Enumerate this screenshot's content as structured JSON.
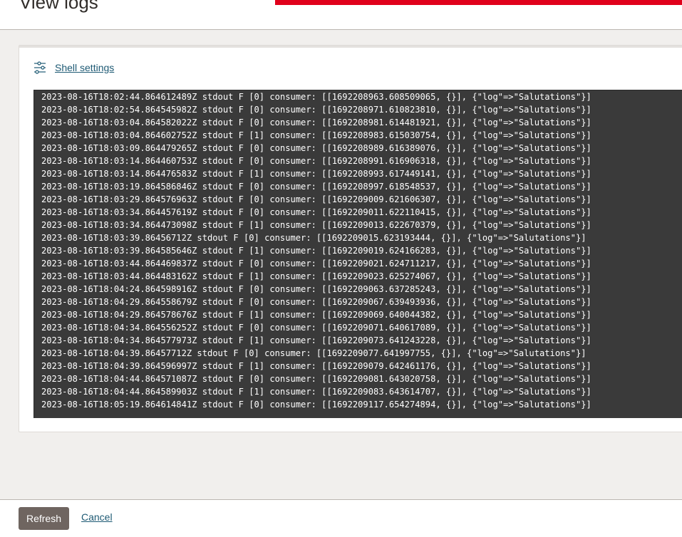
{
  "header": {
    "title": "View logs",
    "accent_color": "#e0001b"
  },
  "panel": {
    "shell_settings_label": "Shell settings",
    "shell_settings_icon": "sliders-icon"
  },
  "logs": [
    "2023-08-16T18:02:44.864612489Z stdout F [0] consumer: [[1692208963.608509065, {}], {\"log\"=>\"Salutations\"}]",
    "2023-08-16T18:02:54.864545982Z stdout F [0] consumer: [[1692208971.610823810, {}], {\"log\"=>\"Salutations\"}]",
    "2023-08-16T18:03:04.864582022Z stdout F [0] consumer: [[1692208981.614481921, {}], {\"log\"=>\"Salutations\"}]",
    "2023-08-16T18:03:04.864602752Z stdout F [1] consumer: [[1692208983.615030754, {}], {\"log\"=>\"Salutations\"}]",
    "2023-08-16T18:03:09.864479265Z stdout F [0] consumer: [[1692208989.616389076, {}], {\"log\"=>\"Salutations\"}]",
    "2023-08-16T18:03:14.864460753Z stdout F [0] consumer: [[1692208991.616906318, {}], {\"log\"=>\"Salutations\"}]",
    "2023-08-16T18:03:14.864476583Z stdout F [1] consumer: [[1692208993.617449141, {}], {\"log\"=>\"Salutations\"}]",
    "2023-08-16T18:03:19.864586846Z stdout F [0] consumer: [[1692208997.618548537, {}], {\"log\"=>\"Salutations\"}]",
    "2023-08-16T18:03:29.864576963Z stdout F [0] consumer: [[1692209009.621606307, {}], {\"log\"=>\"Salutations\"}]",
    "2023-08-16T18:03:34.864457619Z stdout F [0] consumer: [[1692209011.622110415, {}], {\"log\"=>\"Salutations\"}]",
    "2023-08-16T18:03:34.864473098Z stdout F [1] consumer: [[1692209013.622670379, {}], {\"log\"=>\"Salutations\"}]",
    "2023-08-16T18:03:39.86456712Z stdout F [0] consumer: [[1692209015.623193444, {}], {\"log\"=>\"Salutations\"}]",
    "2023-08-16T18:03:39.864585646Z stdout F [1] consumer: [[1692209019.624166283, {}], {\"log\"=>\"Salutations\"}]",
    "2023-08-16T18:03:44.864469837Z stdout F [0] consumer: [[1692209021.624711217, {}], {\"log\"=>\"Salutations\"}]",
    "2023-08-16T18:03:44.864483162Z stdout F [1] consumer: [[1692209023.625274067, {}], {\"log\"=>\"Salutations\"}]",
    "2023-08-16T18:04:24.864598916Z stdout F [0] consumer: [[1692209063.637285243, {}], {\"log\"=>\"Salutations\"}]",
    "2023-08-16T18:04:29.864558679Z stdout F [0] consumer: [[1692209067.639493936, {}], {\"log\"=>\"Salutations\"}]",
    "2023-08-16T18:04:29.864578676Z stdout F [1] consumer: [[1692209069.640044382, {}], {\"log\"=>\"Salutations\"}]",
    "2023-08-16T18:04:34.864556252Z stdout F [0] consumer: [[1692209071.640617089, {}], {\"log\"=>\"Salutations\"}]",
    "2023-08-16T18:04:34.864577973Z stdout F [1] consumer: [[1692209073.641243228, {}], {\"log\"=>\"Salutations\"}]",
    "2023-08-16T18:04:39.86457712Z stdout F [0] consumer: [[1692209077.641997755, {}], {\"log\"=>\"Salutations\"}]",
    "2023-08-16T18:04:39.864596997Z stdout F [1] consumer: [[1692209079.642461176, {}], {\"log\"=>\"Salutations\"}]",
    "2023-08-16T18:04:44.864571087Z stdout F [0] consumer: [[1692209081.643020758, {}], {\"log\"=>\"Salutations\"}]",
    "2023-08-16T18:04:44.864589903Z stdout F [1] consumer: [[1692209083.643614707, {}], {\"log\"=>\"Salutations\"}]",
    "2023-08-16T18:05:19.864614841Z stdout F [0] consumer: [[1692209117.654274894, {}], {\"log\"=>\"Salutations\"}]"
  ],
  "footer": {
    "refresh_label": "Refresh",
    "cancel_label": "Cancel"
  }
}
